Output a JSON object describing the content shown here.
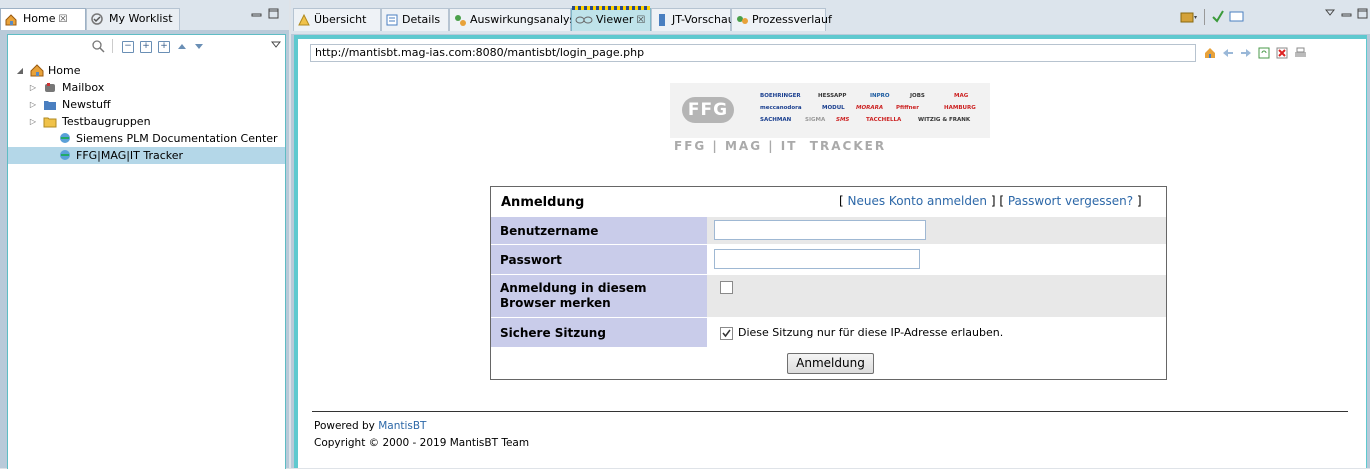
{
  "left_panel": {
    "tabs": [
      {
        "label": "Home",
        "close": "☒"
      },
      {
        "label": "My Worklist"
      }
    ],
    "tree": [
      {
        "label": "Home",
        "expanded": true
      },
      {
        "label": "Mailbox"
      },
      {
        "label": "Newstuff"
      },
      {
        "label": "Testbaugruppen"
      },
      {
        "label": "Siemens PLM Documentation Center"
      },
      {
        "label": "FFG|MAG|IT Tracker",
        "selected": true
      }
    ]
  },
  "right_tabs": [
    {
      "label": "Übersicht",
      "icon": "overview-icon"
    },
    {
      "label": "Details",
      "icon": "details-icon"
    },
    {
      "label": "Auswirkungsanalyse",
      "icon": "impact-analysis-icon"
    },
    {
      "label": "Viewer",
      "icon": "viewer-icon",
      "active": true,
      "close": "☒"
    },
    {
      "label": "JT-Vorschau",
      "icon": "jt-preview-icon"
    },
    {
      "label": "Prozessverlauf",
      "icon": "process-icon"
    }
  ],
  "browser": {
    "url": "http://mantisbt.mag-ias.com:8080/mantisbt/login_page.php"
  },
  "logo": {
    "badge": "FFG",
    "tagline": "FFG | MAG | IT  TRACKER",
    "brands": [
      "BOEHRINGER",
      "HESSAPP",
      "INPRO",
      "JOBS",
      "MAG",
      "meccanodora",
      "MODUL",
      "MORARA",
      "Pfiffner",
      "HAMBURG",
      "SACHMAN",
      "SIGMA",
      "SMS",
      "TACCHELLA",
      "WITZIG & FRANK"
    ]
  },
  "login": {
    "title": "Anmeldung",
    "link_bracket_open": "[",
    "link_bracket_close": "]",
    "new_account": "Neues Konto anmelden",
    "forgot_password": "Passwort vergessen?",
    "username_label": "Benutzername",
    "username_value": "",
    "password_label": "Passwort",
    "password_value": "",
    "remember_label_line1": "Anmeldung in diesem",
    "remember_label_line2": "Browser merken",
    "remember_checked": false,
    "secure_label": "Sichere Sitzung",
    "secure_checked": true,
    "secure_text": "Diese Sitzung nur für diese IP-Adresse erlauben.",
    "submit": "Anmeldung"
  },
  "footer": {
    "powered_by": "Powered by",
    "powered_link": "MantisBT",
    "copyright": "Copyright © 2000 - 2019 MantisBT Team"
  },
  "colors": {
    "accent_frame": "#5fc9cf",
    "label_bg": "#c9ccea",
    "link": "#2d68a8"
  }
}
